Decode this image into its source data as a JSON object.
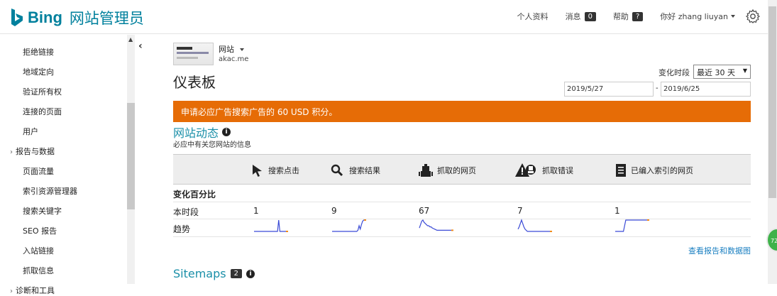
{
  "header": {
    "brand": "Bing",
    "product": "网站管理员",
    "nav": {
      "profile": "个人资料",
      "messages": "消息",
      "messages_count": "0",
      "help": "帮助",
      "help_badge": "?",
      "greeting": "你好 zhang liuyan"
    }
  },
  "sidebar": {
    "items": [
      {
        "label": "拒绝链接",
        "type": "item"
      },
      {
        "label": "地域定向",
        "type": "item"
      },
      {
        "label": "验证所有权",
        "type": "item"
      },
      {
        "label": "连接的页面",
        "type": "item"
      },
      {
        "label": "用户",
        "type": "item"
      },
      {
        "label": "报告与数据",
        "type": "group"
      },
      {
        "label": "页面流量",
        "type": "item"
      },
      {
        "label": "索引资源管理器",
        "type": "item"
      },
      {
        "label": "搜索关键字",
        "type": "item"
      },
      {
        "label": "SEO 报告",
        "type": "item"
      },
      {
        "label": "入站链接",
        "type": "item"
      },
      {
        "label": "抓取信息",
        "type": "item"
      },
      {
        "label": "诊断和工具",
        "type": "group"
      }
    ]
  },
  "site": {
    "label": "网站",
    "url": "akac.me"
  },
  "page_title": "仪表板",
  "period": {
    "label": "变化时段",
    "selected": "最近 30 天",
    "date_from": "2019/5/27",
    "date_to": "2019/6/25",
    "separator": "-"
  },
  "banner": "申请必应广告搜索广告的 60 USD 积分。",
  "activity": {
    "title": "网站动态",
    "subtitle": "必应中有关您网站的信息",
    "columns": [
      {
        "label": "搜索点击",
        "icon": "cursor-icon"
      },
      {
        "label": "搜索结果",
        "icon": "magnifier-icon"
      },
      {
        "label": "抓取的网页",
        "icon": "robot-icon"
      },
      {
        "label": "抓取错误",
        "icon": "crawl-error-icon"
      },
      {
        "label": "已编入索引的网页",
        "icon": "document-icon"
      }
    ],
    "pct_label": "变化百分比",
    "row_current": "本时段",
    "row_trend": "趋势",
    "values": [
      "1",
      "9",
      "67",
      "7",
      "1"
    ],
    "trends": [
      [
        0,
        0,
        0,
        0,
        0,
        0,
        0,
        0,
        0,
        0,
        0,
        0,
        0,
        0,
        0,
        0,
        0,
        0,
        0,
        0,
        0,
        1,
        0,
        0,
        0,
        0,
        0,
        0,
        0,
        0
      ],
      [
        0,
        0,
        0,
        0,
        0,
        0,
        0,
        0,
        0,
        0,
        0,
        0,
        0,
        0,
        0,
        0,
        0,
        0,
        0,
        0,
        0,
        0,
        0.1,
        0.5,
        0.2,
        0.6,
        0.9,
        1,
        1,
        1
      ],
      [
        0.3,
        0.6,
        0.9,
        1,
        0.8,
        0.7,
        0.6,
        0.5,
        0.5,
        0.4,
        0.4,
        0.3,
        0.25,
        0.2,
        0.15,
        0.1,
        0.1,
        0.1,
        0.1,
        0.1,
        0.1,
        0.1,
        0.1,
        0.1,
        0.1,
        0.1,
        0.1,
        0.1,
        0.1,
        0.1
      ],
      [
        0.2,
        0.4,
        0.7,
        1,
        0.7,
        0.4,
        0.2,
        0.1,
        0,
        0,
        0,
        0,
        0,
        0,
        0,
        0,
        0,
        0,
        0,
        0,
        0,
        0,
        0,
        0,
        0,
        0,
        0,
        0,
        0,
        0
      ],
      [
        0,
        0,
        0,
        0,
        0,
        0,
        0,
        0,
        0.5,
        1,
        1,
        1,
        1,
        1,
        1,
        1,
        1,
        1,
        1,
        1,
        1,
        1,
        1,
        1,
        1,
        1,
        1,
        1,
        1,
        1
      ]
    ],
    "view_report": "查看报告和数据图"
  },
  "sitemaps": {
    "title": "Sitemaps",
    "count": "2"
  },
  "float_badge": "72",
  "colors": {
    "brand": "#00809d",
    "banner": "#e66c06",
    "section": "#1a8fa8",
    "link": "#1a7fc1",
    "spark": "#3b4bd6",
    "spark_end": "#f28c1a"
  }
}
